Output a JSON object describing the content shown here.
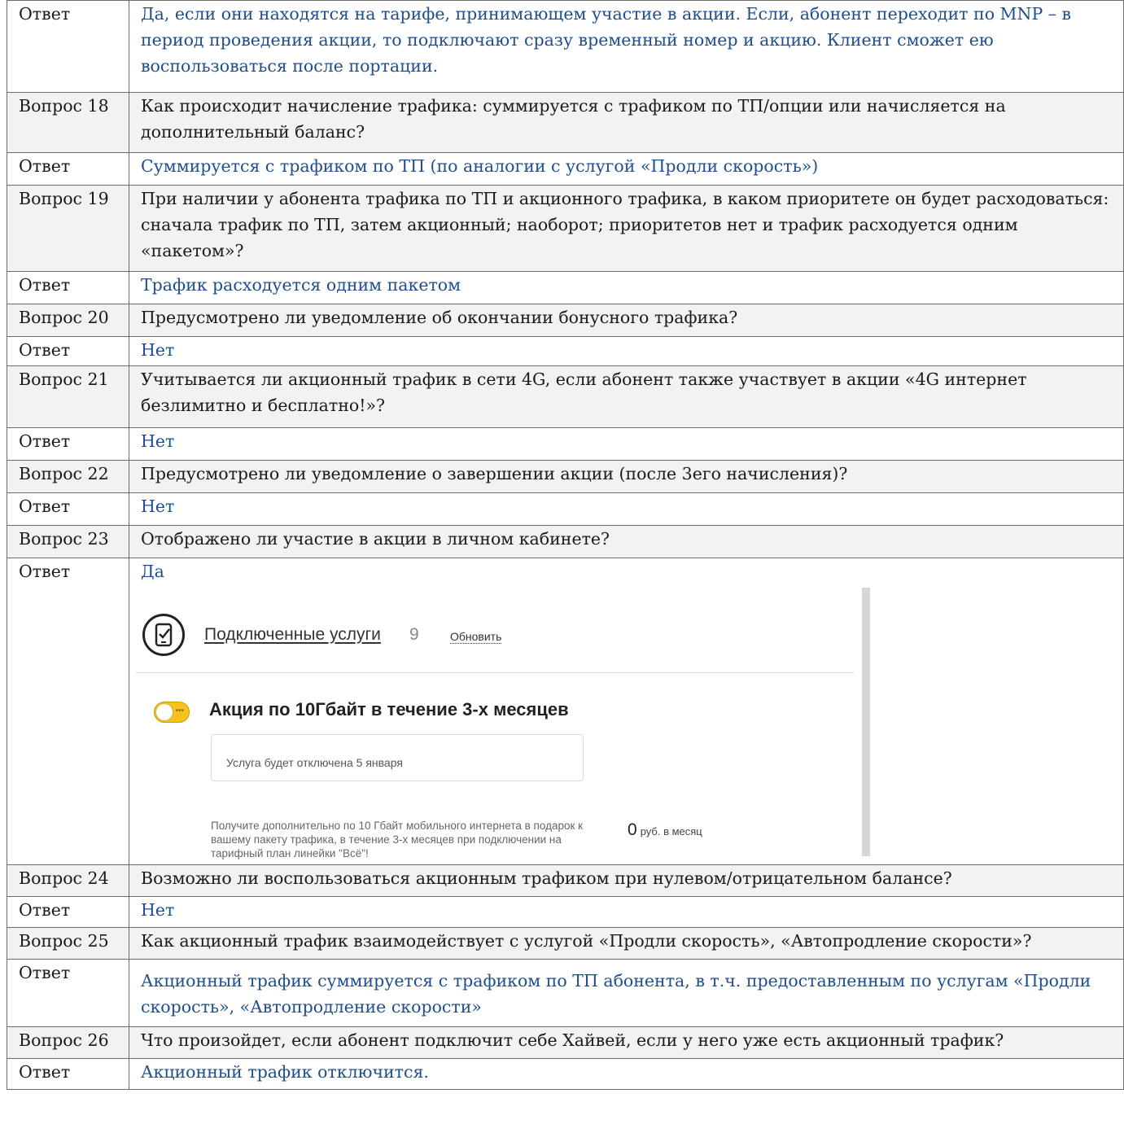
{
  "rows": [
    {
      "kind": "a",
      "label": "Ответ",
      "text": "Да, если они находятся на тарифе, принимающем участие в акции. Если, абонент переходит по MNP –  в период проведения акции, то подключают сразу временный номер и акцию. Клиент сможет ею воспользоваться после портации."
    },
    {
      "kind": "q",
      "label": "Вопрос 18",
      "text": "Как происходит начисление трафика: суммируется с трафиком по ТП/опции или начисляется на дополнительный баланс?"
    },
    {
      "kind": "a",
      "label": "Ответ",
      "text": "Суммируется с трафиком по ТП (по аналогии с услугой «Продли скорость»)"
    },
    {
      "kind": "q",
      "label": "Вопрос 19",
      "text": "При наличии у абонента трафика по ТП и акционного трафика, в каком приоритете он будет расходоваться: сначала трафик по ТП, затем акционный; наоборот; приоритетов нет и трафик расходуется одним «пакетом»?"
    },
    {
      "kind": "a",
      "label": "Ответ",
      "text": "Трафик расходуется одним пакетом"
    },
    {
      "kind": "q",
      "label": "Вопрос 20",
      "text": "Предусмотрено ли уведомление об окончании бонусного трафика?"
    },
    {
      "kind": "a",
      "label": "Ответ",
      "text": "Нет"
    },
    {
      "kind": "q",
      "label": "Вопрос 21",
      "text": "Учитывается ли акционный трафик в сети 4G, если абонент также участвует в акции «4G интернет безлимитно и бесплатно!»?"
    },
    {
      "kind": "a",
      "label": "Ответ",
      "text": "Нет"
    },
    {
      "kind": "q",
      "label": "Вопрос 22",
      "text": "Предусмотрено ли уведомление о завершении акции (после 3его начисления)?"
    },
    {
      "kind": "a",
      "label": "Ответ",
      "text": "Нет"
    },
    {
      "kind": "q",
      "label": "Вопрос 23",
      "text": "Отображено ли участие в акции в личном кабинете?"
    },
    {
      "kind": "a",
      "label": "Ответ",
      "text": "Да"
    },
    {
      "kind": "q",
      "label": "Вопрос 24",
      "text": "Возможно ли воспользоваться акционным трафиком при нулевом/отрицательном балансе?"
    },
    {
      "kind": "a",
      "label": "Ответ",
      "text": "Нет"
    },
    {
      "kind": "q",
      "label": "Вопрос 25",
      "text": "Как акционный трафик взаимодействует с услугой «Продли скорость», «Автопродление скорости»?"
    },
    {
      "kind": "a",
      "label": "Ответ",
      "text": "Акционный трафик суммируется с трафиком по ТП абонента, в т.ч. предоставленным по услугам «Продли скорость», «Автопродление скорости»"
    },
    {
      "kind": "q",
      "label": "Вопрос 26",
      "text": "Что произойдет, если абонент подключит себе Хайвей, если у него уже есть акционный трафик?"
    },
    {
      "kind": "a",
      "label": "Ответ",
      "text": "Акционный трафик отключится."
    }
  ],
  "screenshot": {
    "section_title": "Подключенные услуги",
    "section_count": "9",
    "refresh_link": "Обновить",
    "promo_title": "Акция по 10Гбайт в течение 3-х месяцев",
    "status_text": "Услуга будет отключена 5 января",
    "description": "Получите дополнительно по 10 Гбайт мобильного интернета в подарок к вашему пакету трафика, в течение 3-х месяцев при подключении на тарифный план линейки \"Всё\"!",
    "price_value": "0",
    "price_unit": "руб. в месяц",
    "toggle_on": true
  }
}
